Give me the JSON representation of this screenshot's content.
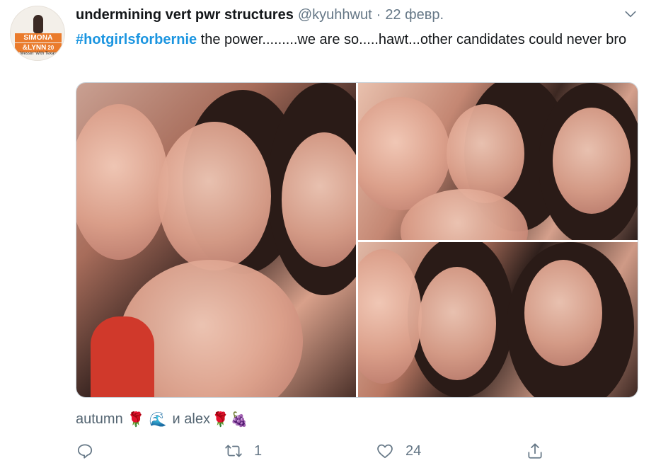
{
  "avatar": {
    "lines": [
      "SIMONA",
      "&LYNN",
      "Messin' With Texas"
    ],
    "year_mark": "20"
  },
  "author": {
    "name": "undermining vert pwr structures",
    "handle": "@kyuhhwut",
    "separator": "·",
    "date": "22 февр."
  },
  "tweet": {
    "hashtag": "#hotgirlsforbernie",
    "text": " the power.........we are so.....hawt...other candidates could never bro"
  },
  "media": {
    "photos": [
      {
        "name": "photo-1"
      },
      {
        "name": "photo-2"
      },
      {
        "name": "photo-3"
      }
    ]
  },
  "tagged": {
    "prefix": "autumn",
    "emoji_1": "🌹",
    "emoji_2": "🌊",
    "middle": "и alex",
    "emoji_3": "🌹",
    "emoji_4": "🍇"
  },
  "actions": {
    "reply_count": "",
    "retweet_count": "1",
    "like_count": "24"
  },
  "icons": {
    "caret": "chevron-down-icon",
    "reply": "reply-icon",
    "retweet": "retweet-icon",
    "like": "heart-icon",
    "share": "share-icon"
  },
  "colors": {
    "link": "#1b95e0",
    "secondary": "#657786",
    "text": "#14171a"
  }
}
